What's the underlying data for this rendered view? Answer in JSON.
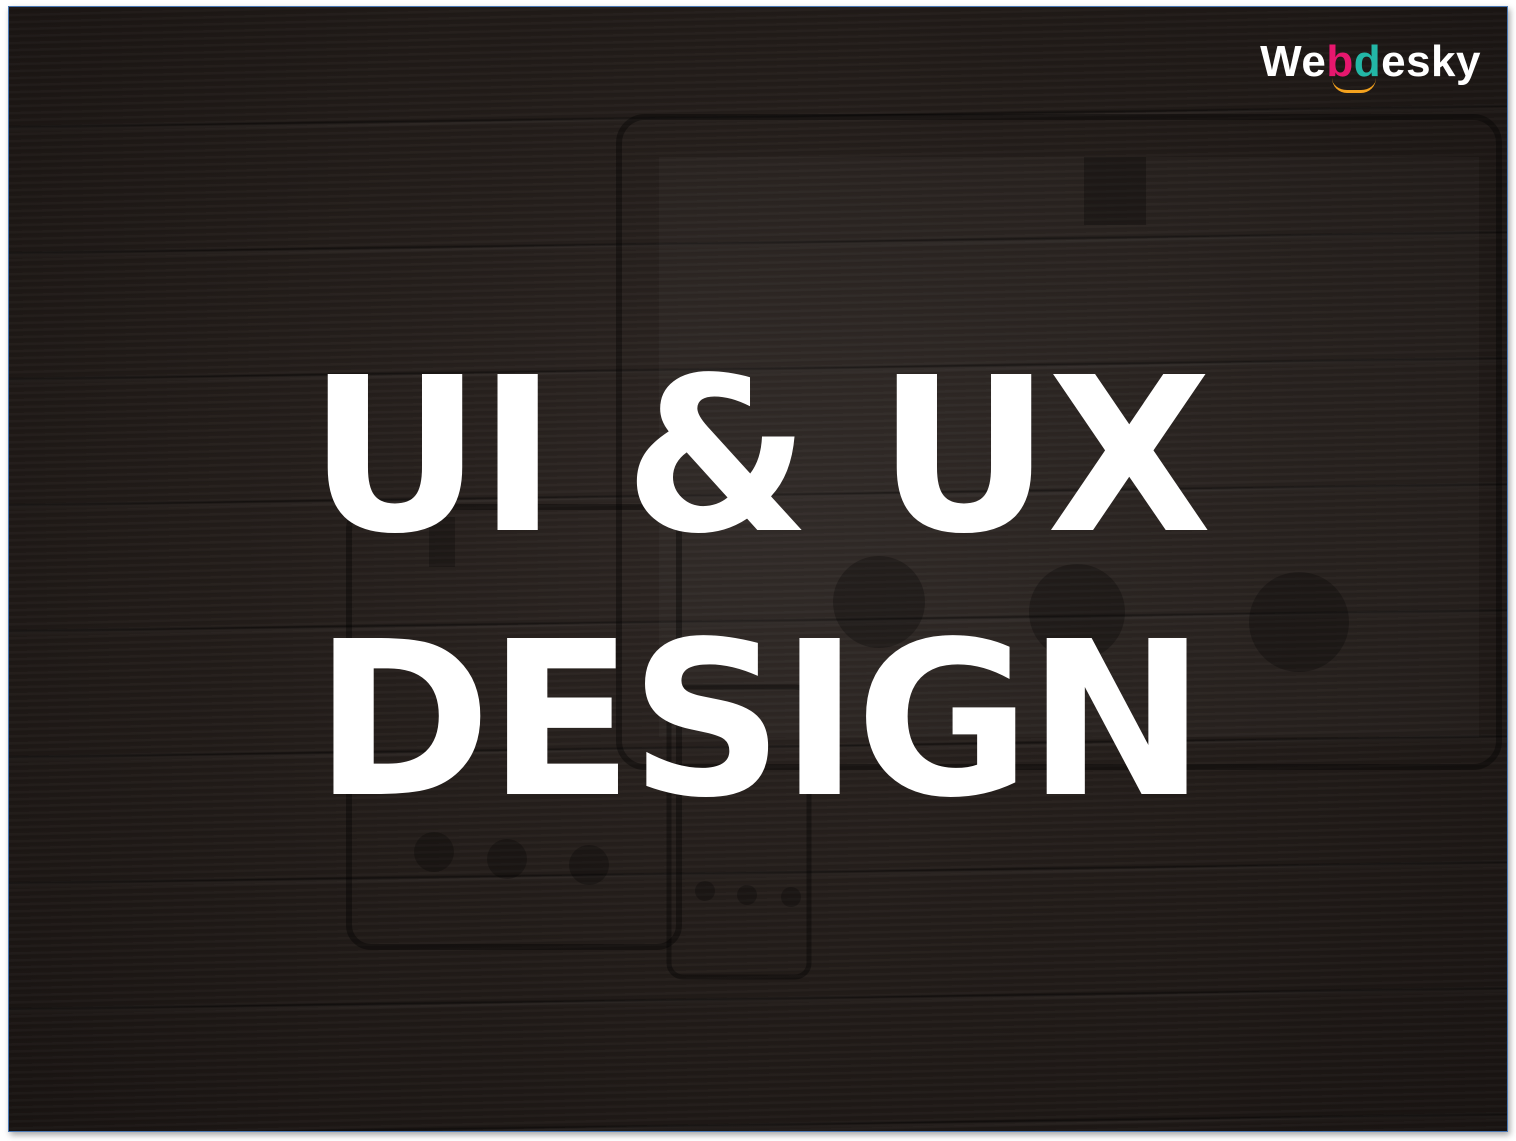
{
  "slide": {
    "title_line1": "UI & UX",
    "title_line2": "DESIGN"
  },
  "brand": {
    "part1": "We",
    "letter_b": "b",
    "letter_d": "d",
    "part2": "esky",
    "colors": {
      "b": "#e6176e",
      "d": "#23b7a6",
      "smile": "#f4a21e"
    }
  },
  "colors": {
    "background": "#231d1a",
    "title_text": "#ffffff",
    "frame_border": "#4a78b4"
  }
}
